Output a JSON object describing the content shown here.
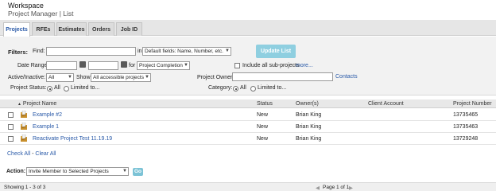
{
  "header": {
    "title": "Workspace",
    "subtitle": "Project Manager | List"
  },
  "tabs": [
    {
      "label": "Projects"
    },
    {
      "label": "RFEs"
    },
    {
      "label": "Estimates"
    },
    {
      "label": "Orders"
    },
    {
      "label": "Job ID"
    }
  ],
  "filters": {
    "title": "Filters:",
    "find_label": "Find:",
    "find_value": "",
    "in_label": "in",
    "in_select": "Default fields: Name, Number, etc.",
    "update_button": "Update List",
    "date_range_label": "Date Range:",
    "date_from": "",
    "date_to": "",
    "for_label": "for",
    "for_select": "Project Completion",
    "include_sub_label": "Include all sub-projects",
    "include_sub_more": "more...",
    "active_label": "Active/Inactive:",
    "active_select": "All",
    "show_label": "Show:",
    "show_select": "All accessible projects",
    "owner_label": "Project Owner:",
    "owner_value": "",
    "contacts_link": "Contacts",
    "status_label": "Project Status:",
    "status_all": "All",
    "status_limited": "Limited to...",
    "category_label": "Category:",
    "category_all": "All",
    "category_limited": "Limited to..."
  },
  "table": {
    "columns": {
      "name": "Project Name",
      "status": "Status",
      "owner": "Owner(s)",
      "client": "Client Account",
      "number": "Project Number"
    },
    "rows": [
      {
        "name": "Example #2",
        "status": "New",
        "owner": "Brian King",
        "client": "",
        "number": "13735465"
      },
      {
        "name": "Example 1",
        "status": "New",
        "owner": "Brian King",
        "client": "",
        "number": "13735463"
      },
      {
        "name": "Reactivate Project Test 11.19.19",
        "status": "New",
        "owner": "Brian King",
        "client": "",
        "number": "13729248"
      }
    ]
  },
  "links": {
    "check_all": "Check All",
    "separator": " - ",
    "clear_all": "Clear All"
  },
  "action": {
    "label": "Action:",
    "select": "Invite Member to Selected Projects",
    "go": "Go"
  },
  "footer": {
    "showing": "Showing 1 - 3 of 3",
    "page": "Page 1 of 1"
  },
  "colors": {
    "accent": "#2a5aa8",
    "update_button": "#8fcfe0",
    "go_button": "#7cc3d6"
  }
}
